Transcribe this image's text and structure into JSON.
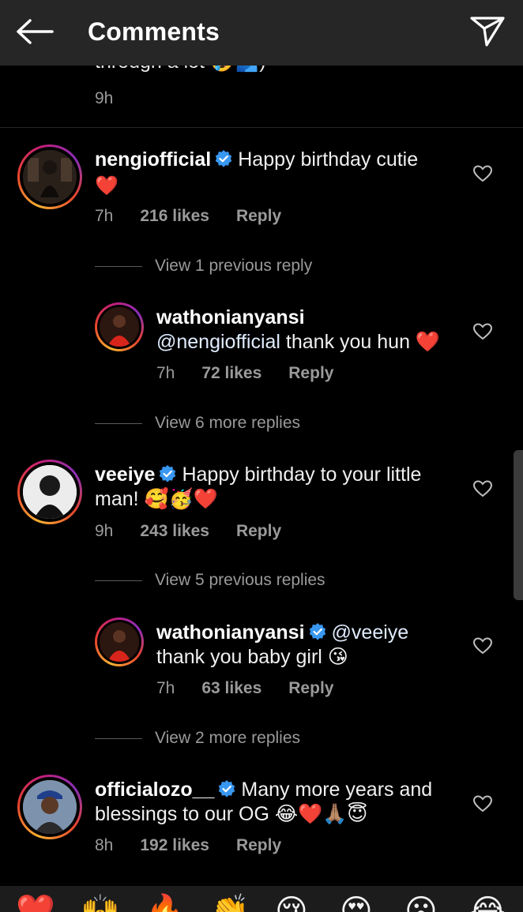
{
  "header": {
    "title": "Comments",
    "back_icon": "arrow-left-icon",
    "send_icon": "paper-plane-icon"
  },
  "top_fragment": {
    "text": "through a lot 🤣🫂)",
    "time": "9h"
  },
  "comments": [
    {
      "username": "nengiofficial",
      "verified": true,
      "text": "Happy birthday cutie",
      "text_line2": "❤️",
      "time": "7h",
      "likes": "216 likes",
      "reply": "Reply",
      "view_more": "View 1 previous reply",
      "replies": [
        {
          "username": "wathonianyansi",
          "verified": false,
          "mention": "@nengiofficial",
          "text": "thank you hun ❤️",
          "time": "7h",
          "likes": "72 likes",
          "reply": "Reply"
        }
      ]
    },
    {
      "username": "veeiye",
      "verified": true,
      "text": "Happy birthday to your little",
      "text_line2": "man! 🥰🥳❤️",
      "time": "9h",
      "likes": "243 likes",
      "reply": "Reply",
      "view_more_before": "View 6 more replies",
      "view_more": "View 5 previous replies",
      "replies": [
        {
          "username": "wathonianyansi",
          "verified": true,
          "mention": "@veeiye",
          "text": "thank you baby girl 😘",
          "time": "7h",
          "likes": "63 likes",
          "reply": "Reply"
        }
      ]
    },
    {
      "username": "officialozo__",
      "verified": true,
      "text": "Many more years and",
      "text_line2": "blessings to our OG 😂❤️🙏🏽😇",
      "time": "8h",
      "likes": "192 likes",
      "reply": "Reply",
      "view_more_before": "View 2 more replies"
    }
  ],
  "emoji_bar": [
    "❤️",
    "🙌",
    "🔥",
    "👏",
    "😢",
    "😍",
    "😮",
    "😂"
  ],
  "colors": {
    "background": "#000000",
    "header": "#262626",
    "secondary_text": "#9a9a9a",
    "verified": "#3897f0"
  }
}
